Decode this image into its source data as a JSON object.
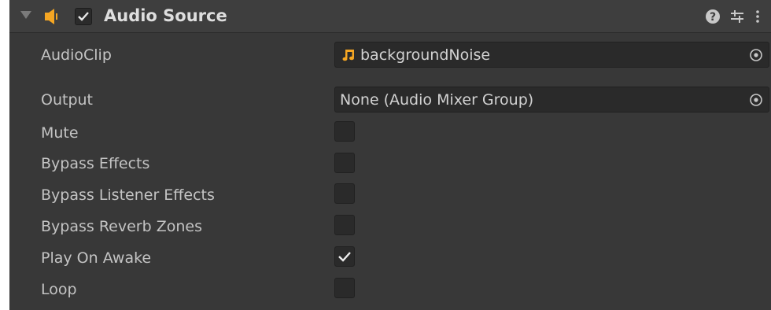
{
  "component": {
    "title": "Audio Source",
    "enabled": true,
    "icons": {
      "foldout": "foldout-triangle-icon",
      "component": "speaker-icon",
      "help": "help-icon",
      "presets": "presets-sliders-icon",
      "menu": "kebab-menu-icon"
    },
    "accent_color": "#f5a623"
  },
  "fields": {
    "audio_clip": {
      "label": "AudioClip",
      "value": "backgroundNoise",
      "icon": "audio-clip-note-icon"
    },
    "output": {
      "label": "Output",
      "value": "None (Audio Mixer Group)"
    }
  },
  "toggles": [
    {
      "label": "Mute",
      "checked": false
    },
    {
      "label": "Bypass Effects",
      "checked": false
    },
    {
      "label": "Bypass Listener Effects",
      "checked": false
    },
    {
      "label": "Bypass Reverb Zones",
      "checked": false
    },
    {
      "label": "Play On Awake",
      "checked": true
    },
    {
      "label": "Loop",
      "checked": false
    }
  ]
}
